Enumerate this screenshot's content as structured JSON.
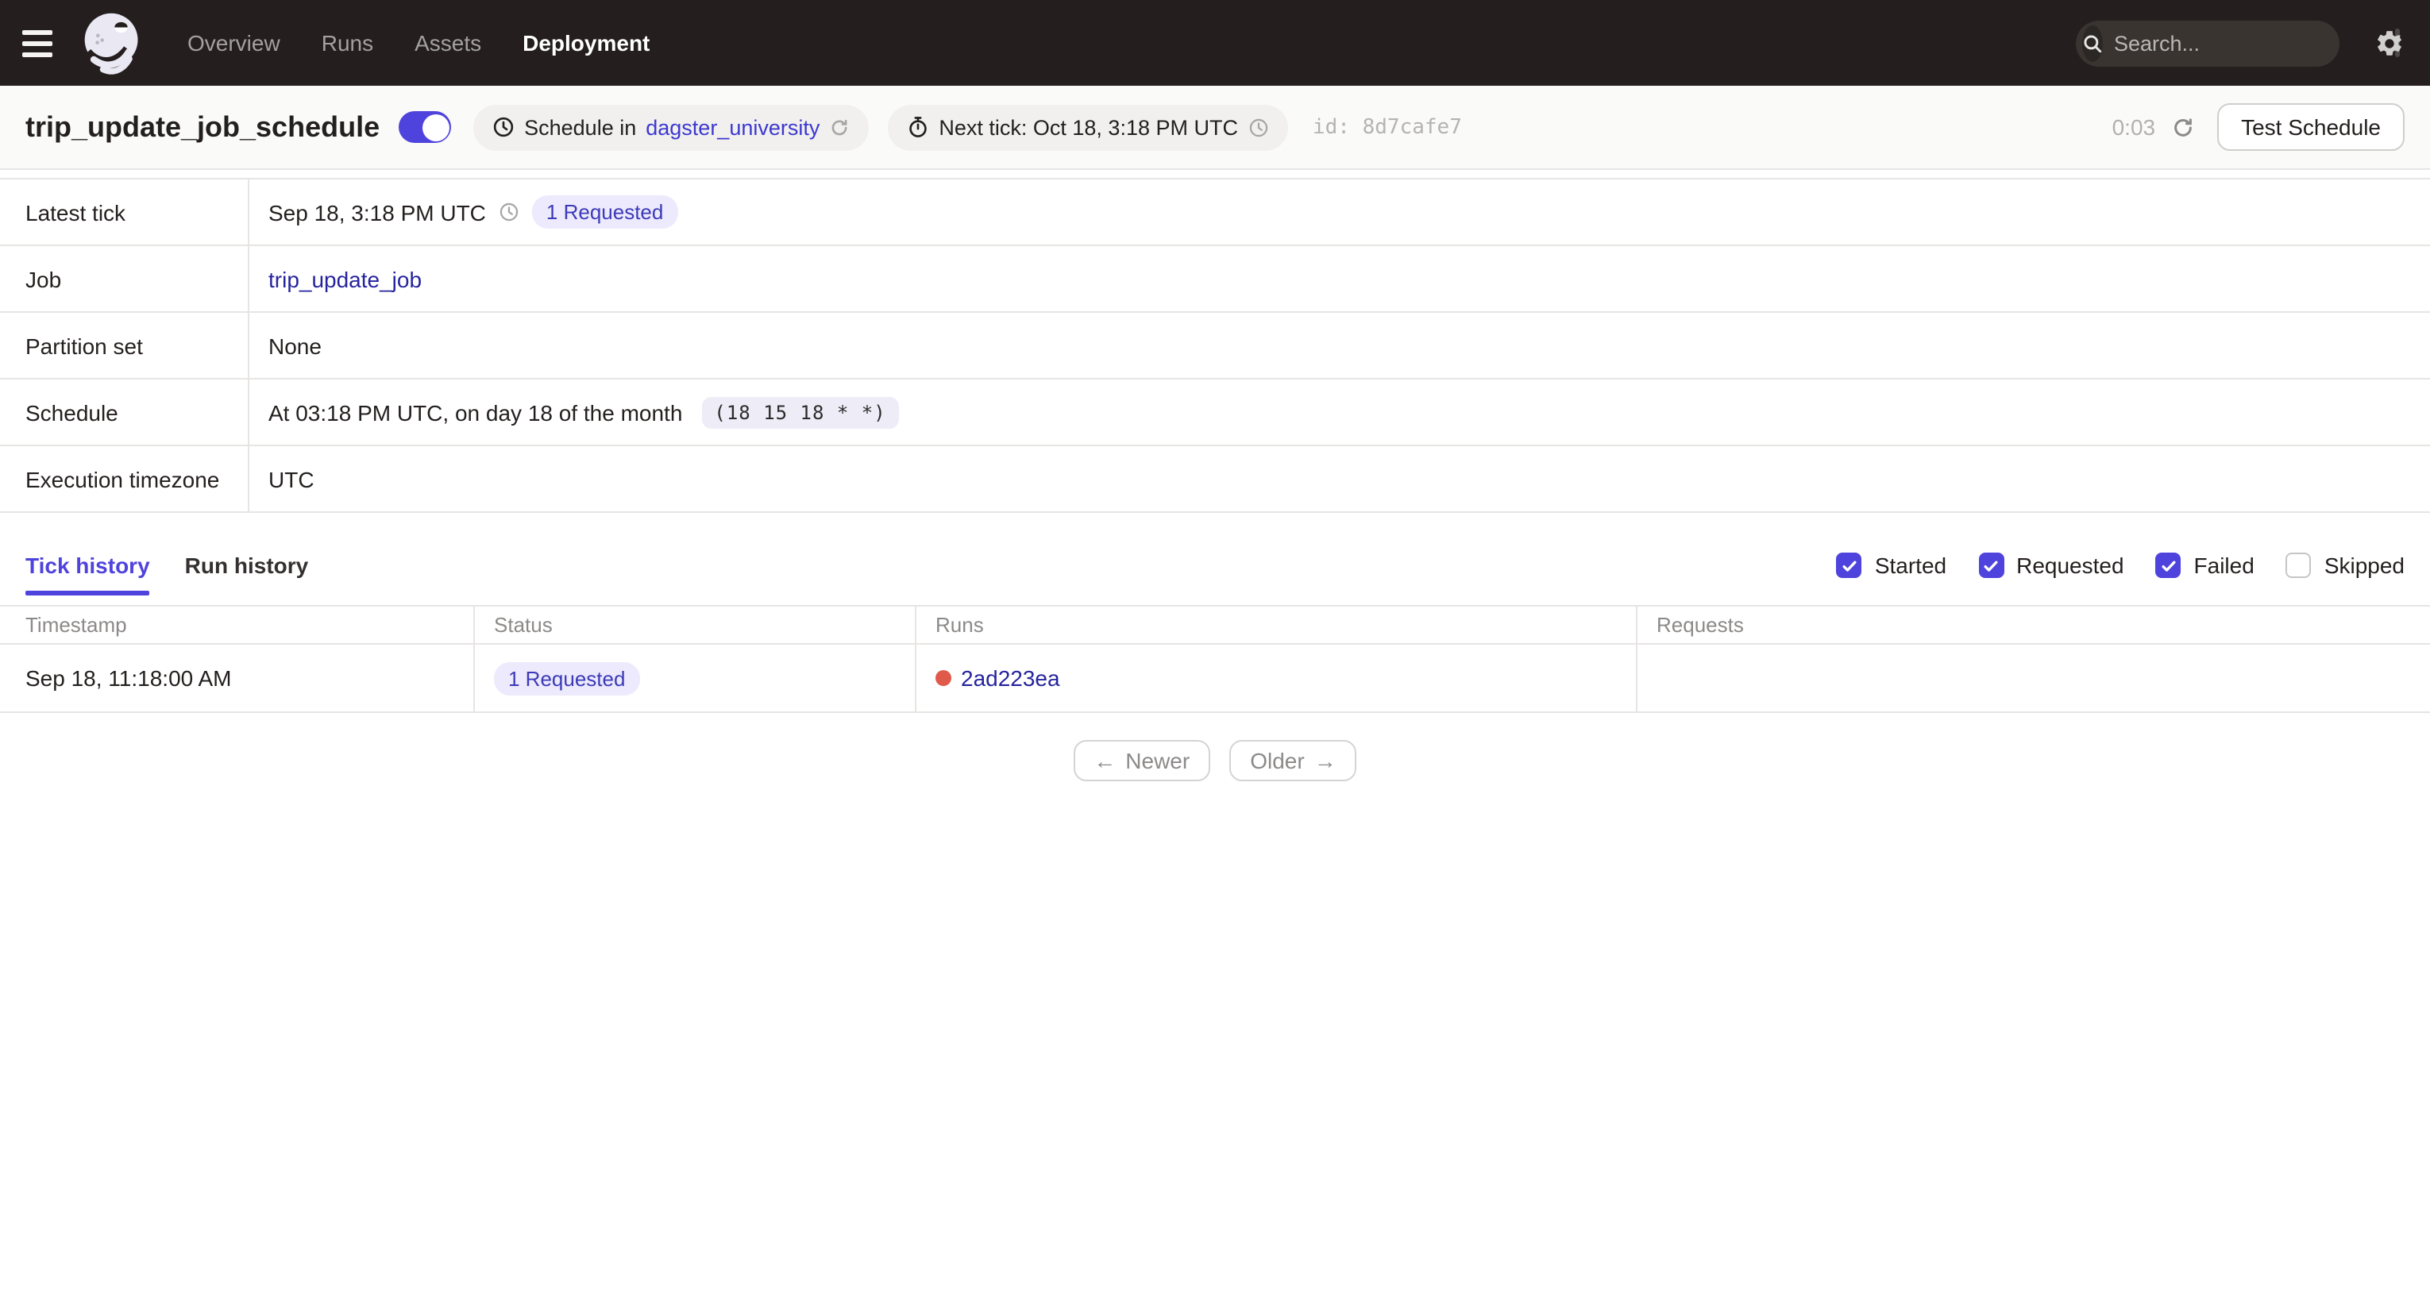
{
  "nav": {
    "items": [
      {
        "label": "Overview"
      },
      {
        "label": "Runs"
      },
      {
        "label": "Assets"
      },
      {
        "label": "Deployment",
        "active": true
      }
    ],
    "search": {
      "placeholder": "Search...",
      "shortcut": "/"
    }
  },
  "header": {
    "title": "trip_update_job_schedule",
    "toggle_on": true,
    "schedule_tag_prefix": "Schedule in",
    "schedule_tag_link": "dagster_university",
    "next_tick_tag": "Next tick: Oct 18, 3:18 PM UTC",
    "id_label": "id:",
    "id_value": "8d7cafe7",
    "countdown": "0:03",
    "test_button": "Test Schedule"
  },
  "details": {
    "rows": [
      {
        "label": "Latest tick",
        "value": "Sep 18, 3:18 PM UTC",
        "badge": "1 Requested"
      },
      {
        "label": "Job",
        "link": "trip_update_job"
      },
      {
        "label": "Partition set",
        "value": "None"
      },
      {
        "label": "Schedule",
        "value": "At 03:18 PM UTC, on day 18 of the month",
        "cron": "(18 15 18 * *)"
      },
      {
        "label": "Execution timezone",
        "value": "UTC"
      }
    ]
  },
  "tabs": [
    {
      "label": "Tick history",
      "active": true
    },
    {
      "label": "Run history",
      "active": false
    }
  ],
  "filters": [
    {
      "label": "Started",
      "checked": true
    },
    {
      "label": "Requested",
      "checked": true
    },
    {
      "label": "Failed",
      "checked": true
    },
    {
      "label": "Skipped",
      "checked": false
    }
  ],
  "tick_table": {
    "columns": [
      "Timestamp",
      "Status",
      "Runs",
      "Requests"
    ],
    "rows": [
      {
        "timestamp": "Sep 18, 11:18:00 AM",
        "status_badge": "1 Requested",
        "run_id": "2ad223ea",
        "run_status": "failure",
        "requests": ""
      }
    ]
  },
  "pagination": {
    "newer": "Newer",
    "older": "Older",
    "newer_arrow": "←",
    "older_arrow": "→"
  },
  "colors": {
    "accent": "#4f43dd",
    "nav_bg": "#241f1e",
    "link": "#26249d",
    "header_link": "#3d38cf",
    "badge_bg": "#eceafc",
    "badge_text": "#3d3ab8",
    "failure_red": "#e05a4b"
  }
}
